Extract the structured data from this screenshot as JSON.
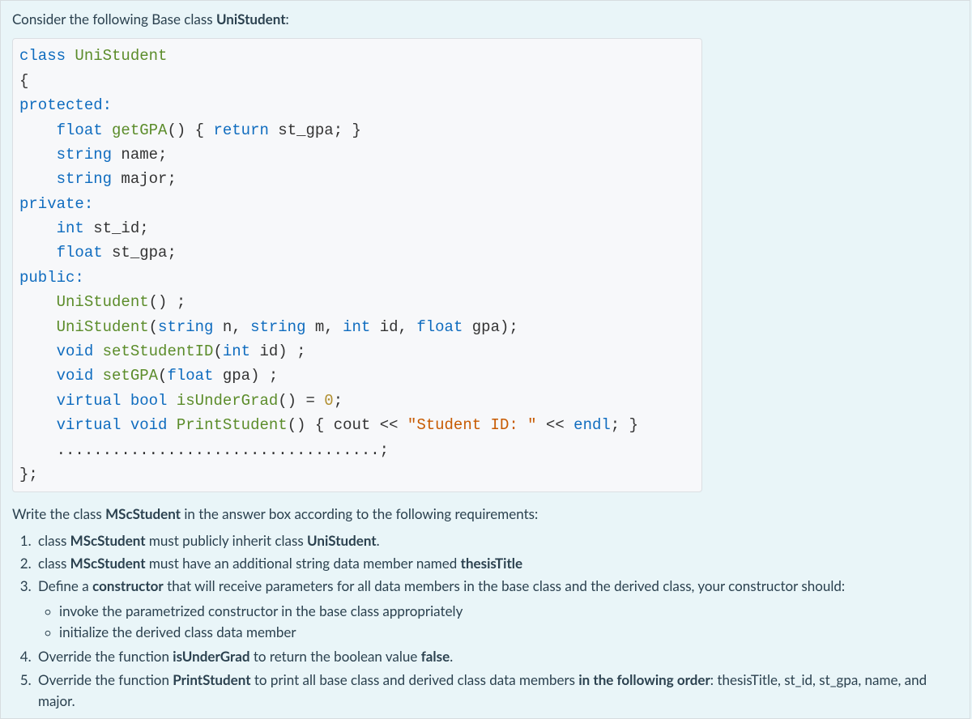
{
  "intro": {
    "prefix": "Consider the following Base class ",
    "bold": "UniStudent",
    "suffix": ":"
  },
  "code": {
    "l01_kw1": "class",
    "l01_name": "UniStudent",
    "l02_brace": "{",
    "l03_access": "protected:",
    "l04_type": "float",
    "l04_fn": "getGPA",
    "l04_paren": "() {",
    "l04_ret": "return",
    "l04_rest": " st_gpa; }",
    "l05_type": "string",
    "l05_rest": " name;",
    "l06_type": "string",
    "l06_rest": " major;",
    "l07_access": "private:",
    "l08_type": "int",
    "l08_rest": " st_id;",
    "l09_type": "float",
    "l09_rest": " st_gpa;",
    "l10_access": "public:",
    "l11_fn": "UniStudent",
    "l11_rest": "() ;",
    "l12_fn": "UniStudent",
    "l12_p1": "(",
    "l12_t1": "string",
    "l12_a1": " n, ",
    "l12_t2": "string",
    "l12_a2": " m, ",
    "l12_t3": "int",
    "l12_a3": " id, ",
    "l12_t4": "float",
    "l12_a4": " gpa);",
    "l13_kw": "void",
    "l13_fn": "setStudentID",
    "l13_p": "(",
    "l13_t": "int",
    "l13_rest": " id) ;",
    "l14_kw": "void",
    "l14_fn": "setGPA",
    "l14_p": "(",
    "l14_t": "float",
    "l14_rest": " gpa) ;",
    "l15_kw1": "virtual",
    "l15_kw2": "bool",
    "l15_fn": "isUnderGrad",
    "l15_rest1": "() = ",
    "l15_num": "0",
    "l15_rest2": ";",
    "l16_kw1": "virtual",
    "l16_kw2": "void",
    "l16_fn": "PrintStudent",
    "l16_rest1": "() { cout << ",
    "l16_str": "\"Student ID: \"",
    "l16_rest2": " << ",
    "l16_endl": "endl",
    "l16_rest3": "; }",
    "l17_dots": "...................................;",
    "l18_close": "};"
  },
  "follow": {
    "prefix": "Write the class ",
    "bold": "MScStudent",
    "suffix": " in the answer box according to the following requirements:"
  },
  "reqs": {
    "r1_a": "class ",
    "r1_b": "MScStudent",
    "r1_c": " must publicly inherit class ",
    "r1_d": "UniStudent",
    "r1_e": ".",
    "r2_a": "class ",
    "r2_b": "MScStudent",
    "r2_c": " must have an additional string data member named ",
    "r2_d": "thesisTitle",
    "r3_a": "Define a ",
    "r3_b": "constructor",
    "r3_c": " that will receive parameters for all data members in the base class and the derived class, your constructor should:",
    "r3_s1": "invoke the parametrized constructor in the base class appropriately",
    "r3_s2": "initialize the derived class data member",
    "r4_a": "Override the function  ",
    "r4_b": "isUnderGrad",
    "r4_c": "  to return the boolean value ",
    "r4_d": "false",
    "r4_e": ".",
    "r5_a": "Override the function ",
    "r5_b": "PrintStudent",
    "r5_c": " to print all base class and derived class data members ",
    "r5_d": "in the following order",
    "r5_e": ":  thesisTitle, st_id,  st_gpa, name, and major."
  }
}
